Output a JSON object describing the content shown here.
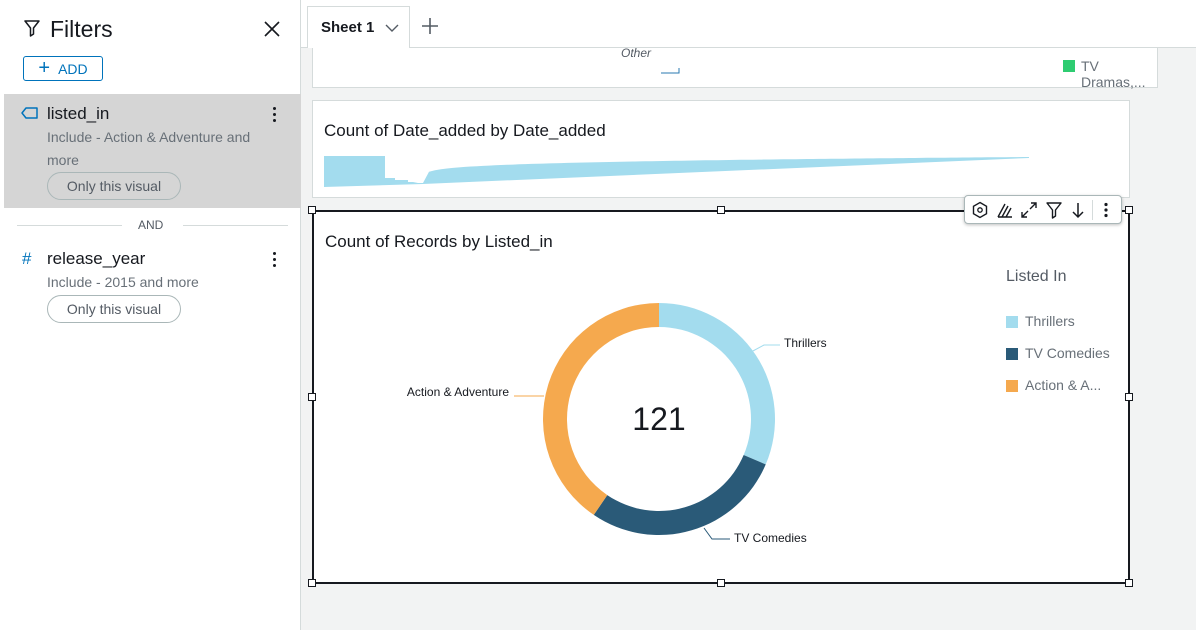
{
  "filters_panel": {
    "title": "Filters",
    "add_label": "ADD",
    "filters": [
      {
        "field": "listed_in",
        "field_icon": "tag-icon",
        "description": "Include - Action & Adventure and more",
        "scope": "Only this visual",
        "selected": true
      },
      {
        "field": "release_year",
        "field_icon": "hash-icon",
        "description": "Include - 2015 and more",
        "scope": "Only this visual",
        "selected": false
      }
    ],
    "combinator": "AND"
  },
  "tabs": [
    {
      "label": "Sheet 1",
      "active": true
    }
  ],
  "visuals": {
    "top": {
      "slice_label": "Other",
      "legend_item": {
        "label": "TV Dramas,...",
        "color": "#2ecc71"
      }
    },
    "date_added": {
      "title": "Count of Date_added by Date_added",
      "color": "#a3dcee"
    },
    "donut": {
      "title": "Count of Records by Listed_in",
      "toolbar": [
        "hexagon-icon",
        "chart-type-icon",
        "expand-icon",
        "filter-icon",
        "sort-down-icon",
        "more-vertical-icon"
      ]
    }
  },
  "chart_data": {
    "type": "pie",
    "title": "Count of Records by Listed_in",
    "donut": true,
    "total_label": "121",
    "legend_title": "Listed In",
    "legend_position": "right",
    "slices": [
      {
        "label": "Thrillers",
        "legend_label": "Thrillers",
        "value": 38,
        "color": "#a3dcee"
      },
      {
        "label": "TV Comedies",
        "legend_label": "TV Comedies",
        "value": 34,
        "color": "#2a5a78"
      },
      {
        "label": "Action & Adventure",
        "legend_label": "Action & A...",
        "value": 49,
        "color": "#f5a94e"
      }
    ]
  }
}
